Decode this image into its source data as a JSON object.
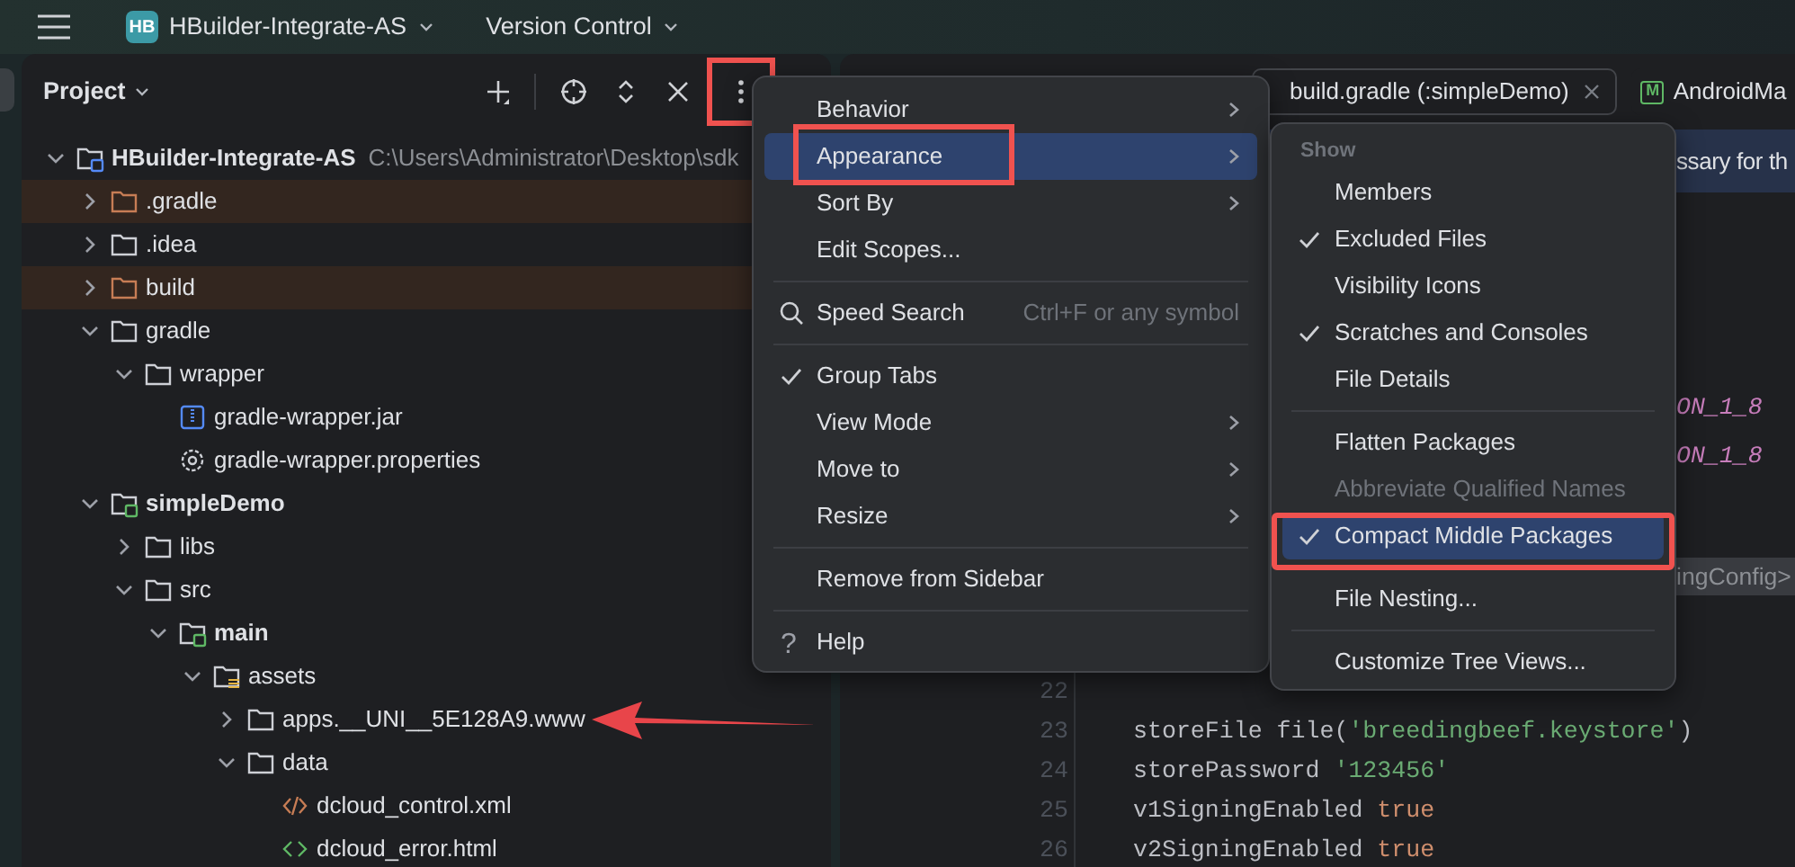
{
  "top_bar": {
    "logo": "HB",
    "project": "HBuilder-Integrate-AS",
    "vcs": "Version Control"
  },
  "project_panel": {
    "title": "Project",
    "toolbar": [
      {
        "kind": "add",
        "highlighted": false
      },
      {
        "kind": "locate",
        "highlighted": false
      },
      {
        "kind": "expand",
        "highlighted": false
      },
      {
        "kind": "close",
        "highlighted": false
      },
      {
        "kind": "more",
        "highlighted": true
      }
    ],
    "tree": [
      {
        "label": "HBuilder-Integrate-AS",
        "path": "C:\\Users\\Administrator\\Desktop\\sdk",
        "kind": "project",
        "expanded": true,
        "excluded": false,
        "children": [
          {
            "label": ".gradle",
            "kind": "folder",
            "expanded": false,
            "excluded": true
          },
          {
            "label": ".idea",
            "kind": "folder",
            "expanded": false,
            "excluded": false
          },
          {
            "label": "build",
            "kind": "folder",
            "expanded": false,
            "excluded": true
          },
          {
            "label": "gradle",
            "kind": "folder",
            "expanded": true,
            "excluded": false,
            "children": [
              {
                "label": "wrapper",
                "kind": "folder",
                "expanded": true,
                "excluded": false,
                "children": [
                  {
                    "label": "gradle-wrapper.jar",
                    "kind": "jar",
                    "excluded": false
                  },
                  {
                    "label": "gradle-wrapper.properties",
                    "kind": "properties",
                    "excluded": false
                  }
                ]
              }
            ]
          },
          {
            "label": "simpleDemo",
            "kind": "module",
            "expanded": true,
            "excluded": false,
            "children": [
              {
                "label": "libs",
                "kind": "folder",
                "expanded": false,
                "excluded": false
              },
              {
                "label": "src",
                "kind": "folder",
                "expanded": true,
                "excluded": false,
                "children": [
                  {
                    "label": "main",
                    "kind": "module",
                    "expanded": true,
                    "excluded": false,
                    "children": [
                      {
                        "label": "assets",
                        "kind": "assets",
                        "expanded": true,
                        "excluded": false,
                        "children": [
                          {
                            "label": "apps.__UNI__5E128A9.www",
                            "kind": "folder",
                            "expanded": false,
                            "excluded": false,
                            "pointed": true
                          },
                          {
                            "label": "data",
                            "kind": "folder",
                            "expanded": true,
                            "excluded": false,
                            "children": [
                              {
                                "label": "dcloud_control.xml",
                                "kind": "xml",
                                "excluded": false
                              },
                              {
                                "label": "dcloud_error.html",
                                "kind": "html",
                                "excluded": false
                              }
                            ]
                          }
                        ]
                      }
                    ]
                  }
                ]
              }
            ]
          }
        ]
      }
    ]
  },
  "options_menu": {
    "items": [
      {
        "kind": "item",
        "label": "Behavior",
        "submenu": true,
        "selected": false,
        "checked": false
      },
      {
        "kind": "item",
        "label": "Appearance",
        "submenu": true,
        "selected": true,
        "checked": false,
        "highlighted": true
      },
      {
        "kind": "item",
        "label": "Sort By",
        "submenu": true,
        "selected": false,
        "checked": false
      },
      {
        "kind": "item",
        "label": "Edit Scopes...",
        "submenu": false,
        "selected": false,
        "checked": false
      },
      {
        "kind": "separator"
      },
      {
        "kind": "search",
        "label": "Speed Search",
        "shortcut": "Ctrl+F or any symbol",
        "submenu": false,
        "selected": false,
        "checked": false
      },
      {
        "kind": "separator"
      },
      {
        "kind": "item",
        "label": "Group Tabs",
        "submenu": false,
        "selected": false,
        "checked": true
      },
      {
        "kind": "item",
        "label": "View Mode",
        "submenu": true,
        "selected": false,
        "checked": false
      },
      {
        "kind": "item",
        "label": "Move to",
        "submenu": true,
        "selected": false,
        "checked": false
      },
      {
        "kind": "item",
        "label": "Resize",
        "submenu": true,
        "selected": false,
        "checked": false
      },
      {
        "kind": "separator"
      },
      {
        "kind": "item",
        "label": "Remove from Sidebar",
        "submenu": false,
        "selected": false,
        "checked": false
      },
      {
        "kind": "separator"
      },
      {
        "kind": "glyph",
        "glyph": "?",
        "label": "Help",
        "submenu": false,
        "selected": false,
        "checked": false
      }
    ]
  },
  "appearance_submenu": {
    "items": [
      {
        "kind": "header",
        "label": "Show"
      },
      {
        "kind": "item",
        "label": "Members",
        "checked": false,
        "selected": false,
        "disabled": false
      },
      {
        "kind": "item",
        "label": "Excluded Files",
        "checked": true,
        "selected": false,
        "disabled": false
      },
      {
        "kind": "item",
        "label": "Visibility Icons",
        "checked": false,
        "selected": false,
        "disabled": false
      },
      {
        "kind": "item",
        "label": "Scratches and Consoles",
        "checked": true,
        "selected": false,
        "disabled": false
      },
      {
        "kind": "item",
        "label": "File Details",
        "checked": false,
        "selected": false,
        "disabled": false
      },
      {
        "kind": "separator"
      },
      {
        "kind": "item",
        "label": "Flatten Packages",
        "checked": false,
        "selected": false,
        "disabled": false
      },
      {
        "kind": "item",
        "label": "Abbreviate Qualified Names",
        "checked": false,
        "selected": false,
        "disabled": true
      },
      {
        "kind": "item",
        "label": "Compact Middle Packages",
        "checked": true,
        "selected": true,
        "disabled": false,
        "highlighted": true
      },
      {
        "kind": "separator"
      },
      {
        "kind": "item",
        "label": "File Nesting...",
        "checked": false,
        "selected": false,
        "disabled": false
      },
      {
        "kind": "separator"
      },
      {
        "kind": "item",
        "label": "Customize Tree Views...",
        "checked": false,
        "selected": false,
        "disabled": false
      }
    ]
  },
  "editor": {
    "tabs": [
      {
        "label": "build.gradle (:simpleDemo)",
        "selected": true,
        "closable": true
      },
      {
        "label": "AndroidMa",
        "badge": "M",
        "selected": false
      }
    ],
    "banner": "ssary for th",
    "fragments": [
      {
        "kind": "constant",
        "text": "ON_1_8"
      },
      {
        "kind": "constant",
        "text": "ON_1_8"
      },
      {
        "kind": "hint",
        "text": "ingConfig>"
      }
    ],
    "lines": [
      {
        "number": "22"
      },
      {
        "number": "23",
        "tokens": [
          {
            "kind": "plain",
            "text": "storeFile file("
          },
          {
            "kind": "string",
            "text": "'breedingbeef.keystore'"
          },
          {
            "kind": "plain",
            "text": ")"
          }
        ]
      },
      {
        "number": "24",
        "tokens": [
          {
            "kind": "plain",
            "text": "storePassword "
          },
          {
            "kind": "string",
            "text": "'123456'"
          }
        ]
      },
      {
        "number": "25",
        "tokens": [
          {
            "kind": "plain",
            "text": "v1SigningEnabled "
          },
          {
            "kind": "keyword",
            "text": "true"
          }
        ]
      },
      {
        "number": "26",
        "tokens": [
          {
            "kind": "plain",
            "text": "v2SigningEnabled "
          },
          {
            "kind": "keyword",
            "text": "true"
          }
        ]
      }
    ]
  }
}
